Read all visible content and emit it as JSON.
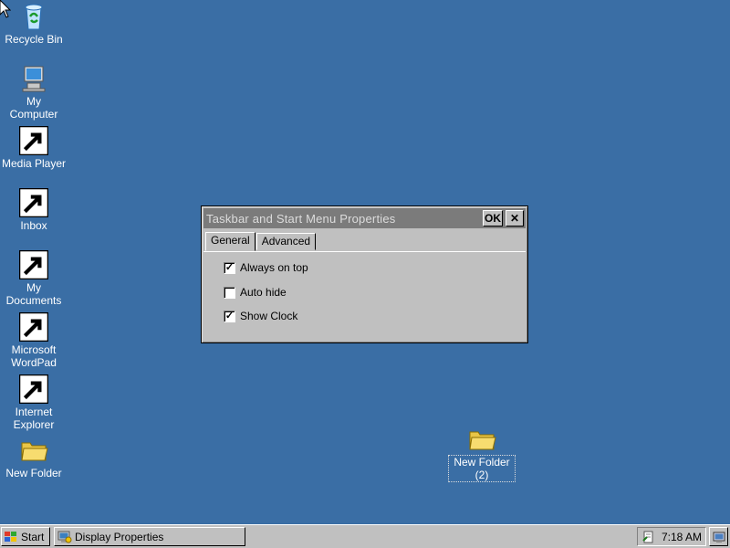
{
  "desktop": {
    "icons": [
      {
        "label": "Recycle Bin"
      },
      {
        "label": "My\nComputer"
      },
      {
        "label": "Media Player"
      },
      {
        "label": "Inbox"
      },
      {
        "label": "My\nDocuments"
      },
      {
        "label": "Microsoft\nWordPad"
      },
      {
        "label": "Internet\nExplorer"
      },
      {
        "label": "New Folder"
      },
      {
        "label": "New Folder\n(2)"
      }
    ]
  },
  "dialog": {
    "title": "Taskbar and Start Menu Properties",
    "ok_label": "OK",
    "close_label": "✕",
    "tabs": [
      {
        "label": "General",
        "active": true
      },
      {
        "label": "Advanced",
        "active": false
      }
    ],
    "options": [
      {
        "label": "Always on top",
        "checked": true
      },
      {
        "label": "Auto hide",
        "checked": false
      },
      {
        "label": "Show Clock",
        "checked": true
      }
    ]
  },
  "taskbar": {
    "start_label": "Start",
    "task_label": "Display Properties",
    "clock": "7:18 AM"
  },
  "colors": {
    "desktop": "#3a6ea5",
    "face": "#c0c0c0",
    "title_inactive": "#7b7b7b"
  }
}
